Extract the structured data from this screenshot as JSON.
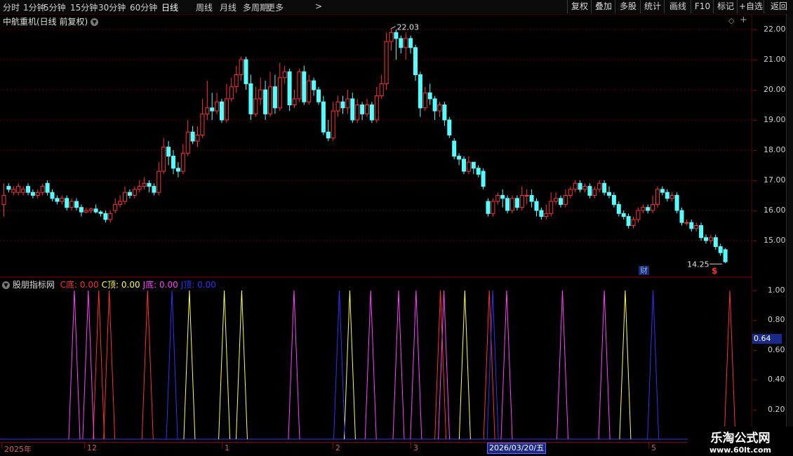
{
  "toolbar": {
    "periods": [
      "分时",
      "1分钟",
      "5分钟",
      "15分钟",
      "30分钟",
      "60分钟",
      "日线",
      "周线",
      "月线",
      "多周期",
      "更多"
    ],
    "active_period": "日线",
    "more_arrow": ">",
    "right_buttons": [
      "复权",
      "叠加",
      "多股",
      "统计",
      "画线",
      "F10",
      "标记",
      "+自选",
      "返回"
    ]
  },
  "main_chart": {
    "title": "中航重机(日线 前复权)",
    "high_label": "22.03",
    "low_label": "14.25",
    "finance_marker": "财",
    "dollar_marker": "$",
    "y_ticks": [
      "22.00",
      "21.00",
      "20.00",
      "19.00",
      "18.00",
      "17.00",
      "16.00",
      "15.00"
    ]
  },
  "indicator": {
    "name": "股朋指标网",
    "items": [
      {
        "label": "C底:",
        "value": "0.00",
        "color": "#ff3030"
      },
      {
        "label": "C顶:",
        "value": "0.00",
        "color": "#ffff40"
      },
      {
        "label": "J底:",
        "value": "0.00",
        "color": "#ff40ff"
      },
      {
        "label": "J顶:",
        "value": "0.00",
        "color": "#3030ff"
      }
    ],
    "y_ticks": [
      "1.00",
      "0.80",
      "0.60",
      "0.40",
      "0.20"
    ],
    "current_value": "0.64"
  },
  "time_axis": {
    "labels": [
      "2025年",
      "12",
      "1",
      "2",
      "3",
      "5"
    ],
    "cursor_date": "2026/03/20/五"
  },
  "watermark": {
    "title": "乐淘公式网",
    "url": "www.60lt.com"
  },
  "chart_data": {
    "type": "candlestick",
    "price_range": [
      14.1,
      22.3
    ],
    "up_color": "#ff3232",
    "down_color": "#54ffff",
    "candles": [
      [
        16.2,
        16.5,
        15.8,
        16.9
      ],
      [
        16.8,
        16.7,
        16.6,
        16.9
      ],
      [
        16.6,
        16.7,
        16.5,
        16.8
      ],
      [
        16.6,
        16.8,
        16.5,
        16.9
      ],
      [
        16.6,
        16.7,
        16.5,
        16.8
      ],
      [
        16.8,
        16.6,
        16.5,
        16.9
      ],
      [
        16.6,
        16.5,
        16.4,
        16.7
      ],
      [
        16.5,
        16.6,
        16.4,
        16.7
      ],
      [
        16.6,
        16.8,
        16.5,
        16.9
      ],
      [
        16.9,
        16.6,
        16.5,
        17.0
      ],
      [
        16.6,
        16.4,
        16.3,
        16.7
      ],
      [
        16.4,
        16.3,
        16.2,
        16.5
      ],
      [
        16.3,
        16.4,
        16.2,
        16.5
      ],
      [
        16.4,
        16.1,
        16.0,
        16.5
      ],
      [
        16.1,
        16.3,
        16.0,
        16.4
      ],
      [
        16.3,
        16.1,
        16.0,
        16.4
      ],
      [
        16.1,
        15.95,
        15.8,
        16.2
      ],
      [
        15.95,
        16.0,
        15.9,
        16.1
      ],
      [
        16.0,
        16.05,
        15.9,
        16.1
      ],
      [
        16.05,
        15.95,
        15.9,
        16.2
      ],
      [
        15.95,
        15.9,
        15.8,
        16.0
      ],
      [
        15.9,
        15.7,
        15.6,
        16.0
      ],
      [
        15.7,
        15.9,
        15.6,
        16.0
      ],
      [
        16.0,
        16.2,
        15.9,
        16.4
      ],
      [
        16.2,
        16.3,
        16.1,
        16.5
      ],
      [
        16.3,
        16.6,
        16.2,
        16.8
      ],
      [
        16.6,
        16.5,
        16.4,
        16.7
      ],
      [
        16.5,
        16.7,
        16.4,
        16.8
      ],
      [
        16.7,
        16.8,
        16.6,
        17.0
      ],
      [
        16.8,
        16.9,
        16.7,
        17.1
      ],
      [
        16.9,
        16.8,
        16.6,
        17.0
      ],
      [
        16.8,
        16.6,
        16.5,
        16.9
      ],
      [
        16.6,
        17.3,
        16.5,
        17.6
      ],
      [
        17.3,
        18.1,
        17.2,
        18.4
      ],
      [
        18.1,
        17.8,
        17.5,
        18.3
      ],
      [
        17.8,
        17.4,
        17.2,
        18.0
      ],
      [
        17.4,
        17.3,
        17.1,
        17.6
      ],
      [
        17.3,
        17.9,
        17.2,
        18.2
      ],
      [
        17.9,
        18.6,
        17.8,
        19.0
      ],
      [
        18.6,
        18.3,
        18.2,
        18.8
      ],
      [
        18.3,
        18.5,
        18.1,
        18.8
      ],
      [
        18.5,
        19.2,
        18.4,
        19.7
      ],
      [
        19.2,
        19.4,
        19.0,
        20.3
      ],
      [
        19.4,
        19.3,
        19.0,
        19.9
      ],
      [
        19.3,
        19.6,
        19.2,
        19.9
      ],
      [
        19.6,
        19.0,
        18.9,
        19.7
      ],
      [
        19.0,
        19.7,
        18.9,
        20.2
      ],
      [
        19.7,
        20.1,
        19.6,
        20.4
      ],
      [
        20.1,
        20.5,
        19.9,
        20.8
      ],
      [
        20.5,
        21.0,
        20.3,
        21.1
      ],
      [
        21.0,
        20.2,
        20.0,
        21.1
      ],
      [
        20.2,
        19.2,
        19.0,
        20.5
      ],
      [
        19.2,
        19.7,
        19.1,
        20.1
      ],
      [
        19.7,
        20.0,
        19.5,
        20.4
      ],
      [
        20.0,
        19.2,
        19.0,
        20.3
      ],
      [
        19.2,
        20.1,
        19.1,
        20.6
      ],
      [
        20.1,
        19.4,
        19.2,
        20.5
      ],
      [
        19.4,
        20.4,
        19.3,
        20.9
      ],
      [
        20.4,
        20.6,
        20.2,
        20.8
      ],
      [
        20.6,
        19.5,
        19.3,
        20.7
      ],
      [
        19.5,
        19.7,
        19.4,
        20.0
      ],
      [
        19.7,
        20.6,
        19.6,
        20.7
      ],
      [
        20.6,
        19.6,
        19.5,
        20.8
      ],
      [
        19.6,
        20.3,
        19.5,
        20.5
      ],
      [
        20.3,
        20.0,
        19.8,
        20.4
      ],
      [
        20.0,
        19.6,
        19.5,
        20.1
      ],
      [
        19.6,
        18.6,
        18.5,
        19.8
      ],
      [
        18.6,
        18.4,
        18.3,
        19.0
      ],
      [
        18.4,
        19.3,
        18.3,
        19.6
      ],
      [
        19.3,
        19.6,
        19.1,
        19.8
      ],
      [
        19.6,
        19.4,
        19.2,
        19.8
      ],
      [
        19.4,
        19.7,
        19.2,
        20.0
      ],
      [
        19.7,
        19.0,
        18.9,
        19.9
      ],
      [
        19.0,
        19.5,
        18.9,
        19.7
      ],
      [
        19.5,
        19.2,
        19.0,
        19.6
      ],
      [
        19.2,
        19.5,
        19.1,
        19.7
      ],
      [
        19.5,
        19.0,
        18.9,
        19.6
      ],
      [
        19.0,
        19.8,
        18.9,
        20.1
      ],
      [
        19.8,
        20.2,
        19.7,
        20.5
      ],
      [
        20.2,
        21.6,
        20.0,
        21.9
      ],
      [
        21.6,
        21.9,
        21.3,
        22.03
      ],
      [
        21.9,
        21.7,
        21.0,
        22.0
      ],
      [
        21.7,
        21.4,
        21.2,
        21.8
      ],
      [
        21.4,
        21.7,
        21.0,
        21.9
      ],
      [
        21.7,
        21.4,
        21.2,
        21.8
      ],
      [
        21.4,
        20.5,
        20.3,
        21.5
      ],
      [
        20.5,
        19.4,
        19.1,
        20.6
      ],
      [
        19.4,
        19.9,
        19.3,
        20.1
      ],
      [
        19.9,
        19.7,
        19.5,
        20.2
      ],
      [
        19.7,
        19.3,
        19.0,
        19.8
      ],
      [
        19.3,
        19.5,
        19.1,
        19.6
      ],
      [
        19.5,
        19.0,
        18.8,
        19.6
      ],
      [
        19.0,
        18.5,
        18.4,
        19.1
      ],
      [
        18.3,
        17.8,
        17.7,
        18.4
      ],
      [
        17.8,
        17.7,
        17.5,
        17.9
      ],
      [
        17.7,
        17.3,
        17.2,
        17.8
      ],
      [
        17.3,
        17.6,
        17.2,
        17.8
      ],
      [
        17.6,
        17.4,
        17.2,
        17.6
      ],
      [
        17.4,
        17.2,
        17.1,
        17.5
      ],
      [
        17.3,
        16.8,
        16.7,
        17.4
      ],
      [
        16.3,
        15.9,
        15.8,
        16.4
      ],
      [
        15.9,
        16.3,
        15.8,
        16.4
      ],
      [
        16.3,
        16.5,
        16.2,
        16.6
      ],
      [
        16.5,
        16.4,
        16.1,
        16.7
      ],
      [
        16.4,
        16.0,
        15.9,
        16.5
      ],
      [
        16.0,
        16.4,
        15.9,
        16.5
      ],
      [
        16.4,
        16.1,
        16.0,
        16.5
      ],
      [
        16.1,
        16.5,
        16.0,
        16.8
      ],
      [
        16.5,
        16.5,
        16.2,
        16.7
      ],
      [
        16.5,
        16.3,
        16.1,
        16.7
      ],
      [
        16.3,
        16.0,
        15.8,
        16.4
      ],
      [
        16.0,
        15.8,
        15.7,
        16.1
      ],
      [
        15.8,
        15.9,
        15.7,
        16.2
      ],
      [
        15.9,
        16.3,
        15.8,
        16.6
      ],
      [
        16.3,
        16.4,
        16.2,
        16.6
      ],
      [
        16.4,
        16.2,
        16.1,
        16.5
      ],
      [
        16.2,
        16.5,
        16.1,
        16.7
      ],
      [
        16.5,
        16.7,
        16.4,
        16.8
      ],
      [
        16.7,
        16.9,
        16.6,
        17.0
      ],
      [
        16.9,
        16.7,
        16.6,
        17.0
      ],
      [
        16.7,
        16.8,
        16.6,
        16.9
      ],
      [
        16.8,
        16.5,
        16.4,
        16.9
      ],
      [
        16.5,
        16.7,
        16.4,
        16.8
      ],
      [
        16.7,
        16.9,
        16.6,
        17.0
      ],
      [
        16.9,
        16.6,
        16.5,
        17.0
      ],
      [
        16.6,
        16.5,
        16.4,
        16.8
      ],
      [
        16.5,
        16.2,
        16.1,
        16.6
      ],
      [
        16.2,
        15.9,
        15.8,
        16.3
      ],
      [
        15.9,
        15.8,
        15.7,
        16.0
      ],
      [
        15.8,
        15.5,
        15.4,
        15.9
      ],
      [
        15.5,
        15.7,
        15.4,
        15.8
      ],
      [
        15.7,
        16.0,
        15.6,
        16.1
      ],
      [
        16.0,
        16.1,
        15.9,
        16.2
      ],
      [
        16.1,
        16.0,
        15.9,
        16.2
      ],
      [
        16.0,
        16.2,
        15.9,
        16.5
      ],
      [
        16.2,
        16.7,
        16.1,
        16.8
      ],
      [
        16.7,
        16.6,
        16.5,
        16.8
      ],
      [
        16.6,
        16.4,
        16.3,
        16.7
      ],
      [
        16.4,
        16.5,
        16.3,
        16.6
      ],
      [
        16.5,
        16.0,
        15.9,
        16.6
      ],
      [
        16.0,
        15.6,
        15.5,
        16.1
      ],
      [
        15.6,
        15.6,
        15.5,
        15.7
      ],
      [
        15.6,
        15.4,
        15.3,
        15.7
      ],
      [
        15.4,
        15.5,
        15.3,
        15.6
      ],
      [
        15.5,
        15.1,
        15.0,
        15.6
      ],
      [
        15.1,
        15.0,
        14.9,
        15.2
      ],
      [
        15.0,
        15.1,
        14.9,
        15.2
      ],
      [
        15.1,
        14.8,
        14.7,
        15.2
      ],
      [
        14.8,
        14.6,
        14.5,
        14.9
      ],
      [
        14.7,
        14.3,
        14.25,
        14.75
      ]
    ],
    "indicator_series": [
      {
        "name": "C底",
        "color": "#ff3030",
        "peaks": [
          8,
          11,
          22,
          106,
          120,
          195
        ]
      },
      {
        "name": "C顶",
        "color": "#ffff40",
        "peaks": [
          34,
          44,
          49,
          80,
          113,
          159
        ]
      },
      {
        "name": "J底",
        "color": "#ff40ff",
        "peaks": [
          1,
          5,
          64,
          86,
          94,
          99,
          107,
          125,
          141,
          153
        ]
      },
      {
        "name": "J顶",
        "color": "#3030ff",
        "peaks": [
          29,
          77,
          121,
          167
        ]
      }
    ],
    "indicator_range": [
      0,
      1.0
    ]
  }
}
